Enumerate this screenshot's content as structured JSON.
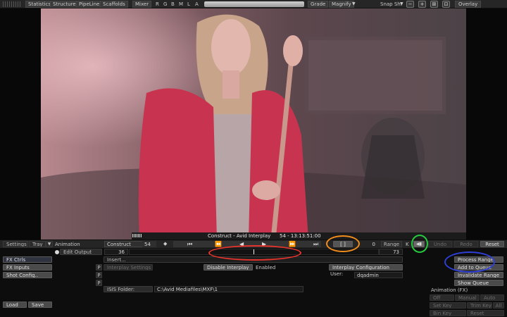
{
  "top_menu": {
    "statistics": "Statistics",
    "structure": "Structure",
    "pipeline": "PipeLine",
    "scaffolds": "Scaffolds",
    "mixer": "Mixer",
    "channels": [
      "R",
      "G",
      "B",
      "M",
      "L",
      "A"
    ],
    "grade": "Grade",
    "magnify": "Magnify",
    "snap": "Snap Sh.",
    "overlay": "Overlay"
  },
  "viewer": {
    "caption": "Construct - Avid Interplay",
    "timecode": "54 - 13:13:51:00"
  },
  "tabs": {
    "settings": "Settings",
    "tray": "Tray",
    "animation": "Animation",
    "construct": "Construct",
    "frame": "54",
    "range_start": "0",
    "range": "Range",
    "k": "K",
    "undo": "Undo",
    "redo": "Redo",
    "reset": "Reset"
  },
  "edit_output": {
    "label": "Edit Output",
    "in_value": "36",
    "out_value": "73"
  },
  "left_buttons": {
    "fx_ctrls": "FX Ctrls",
    "fx_inputs": "FX Inputs",
    "shot_config": "Shot Config..",
    "load": "Load",
    "save": "Save"
  },
  "middle": {
    "insert": "Insert...",
    "p1": "P",
    "p2": "P",
    "p3": "P",
    "interplay_settings": "Interplay Settings",
    "disable_interplay": "Disable Interplay",
    "enabled": "Enabled",
    "interplay_configuration": "Interplay Configuration",
    "user_label": "User:",
    "user_value": "dqadmin",
    "isis_label": "ISIS Folder:",
    "isis_path": "C:\\Avid Mediafiles\\MXF\\1"
  },
  "right_buttons": {
    "process_range": "Process Range",
    "add_to_queue": "Add to Queue",
    "invalidate_range": "Invalidate Range",
    "show_queue": "Show Queue"
  },
  "animation_fx": {
    "title": "Animation (FX)",
    "off": "Off",
    "manual": "Manual",
    "auto": "Auto",
    "set_key": "Set Key",
    "trim_key": "Trim Key",
    "all": "All",
    "bin_key": "Bin Key",
    "reset": "Reset"
  },
  "colors": {
    "annotation_red": "#e8342c",
    "annotation_orange": "#f28c1c",
    "annotation_green": "#27c93f",
    "annotation_blue": "#2f3fd6"
  }
}
